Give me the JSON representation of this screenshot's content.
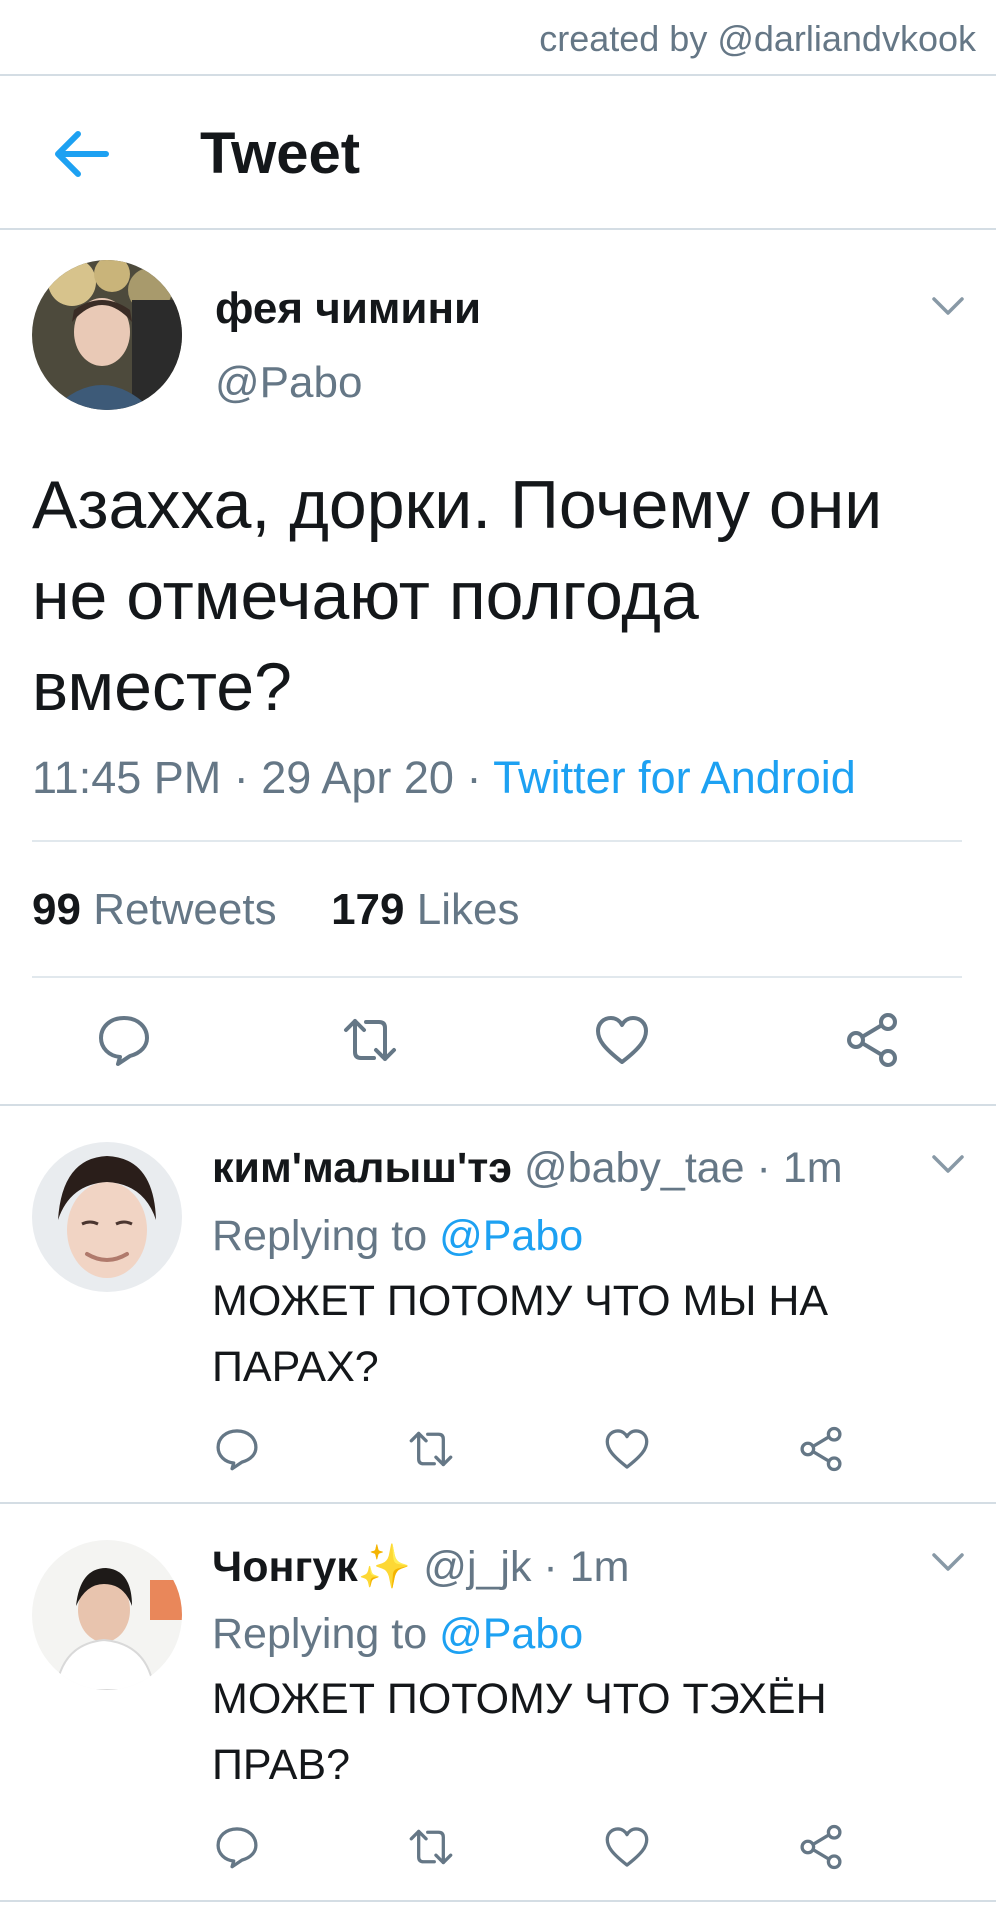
{
  "credit": "created by @darliandvkook",
  "header": {
    "title": "Tweet"
  },
  "main_tweet": {
    "display_name": "фея чимини",
    "handle": "@Pabo",
    "text": "Азахха, дорки. Почему они не отмечают полгода вместе?",
    "time": "11:45 PM",
    "date": "29 Apr 20",
    "source": "Twitter for Android",
    "retweets_count": "99",
    "retweets_label": "Retweets",
    "likes_count": "179",
    "likes_label": "Likes"
  },
  "replies": [
    {
      "display_name": "ким'малыш'тэ",
      "handle": "@baby_tae",
      "time": "1m",
      "replying_prefix": "Replying to",
      "replying_to": "@Pabo",
      "text": "МОЖЕТ ПОТОМУ ЧТО МЫ НА ПАРАХ?"
    },
    {
      "display_name": "Чонгук",
      "emoji": "✨",
      "handle": "@j_jk",
      "time": "1m",
      "replying_prefix": "Replying to",
      "replying_to": "@Pabo",
      "text": "МОЖЕТ ПОТОМУ ЧТО ТЭХЁН ПРАВ?"
    }
  ],
  "separator": " · ",
  "icons": {
    "back": "arrow-left-icon",
    "reply": "reply-icon",
    "retweet": "retweet-icon",
    "like": "heart-icon",
    "share": "share-icon",
    "more": "chevron-down-icon"
  },
  "colors": {
    "accent": "#1da1f2",
    "secondary_text": "#657786",
    "primary_text": "#14171a",
    "divider": "#e1e8ed"
  }
}
